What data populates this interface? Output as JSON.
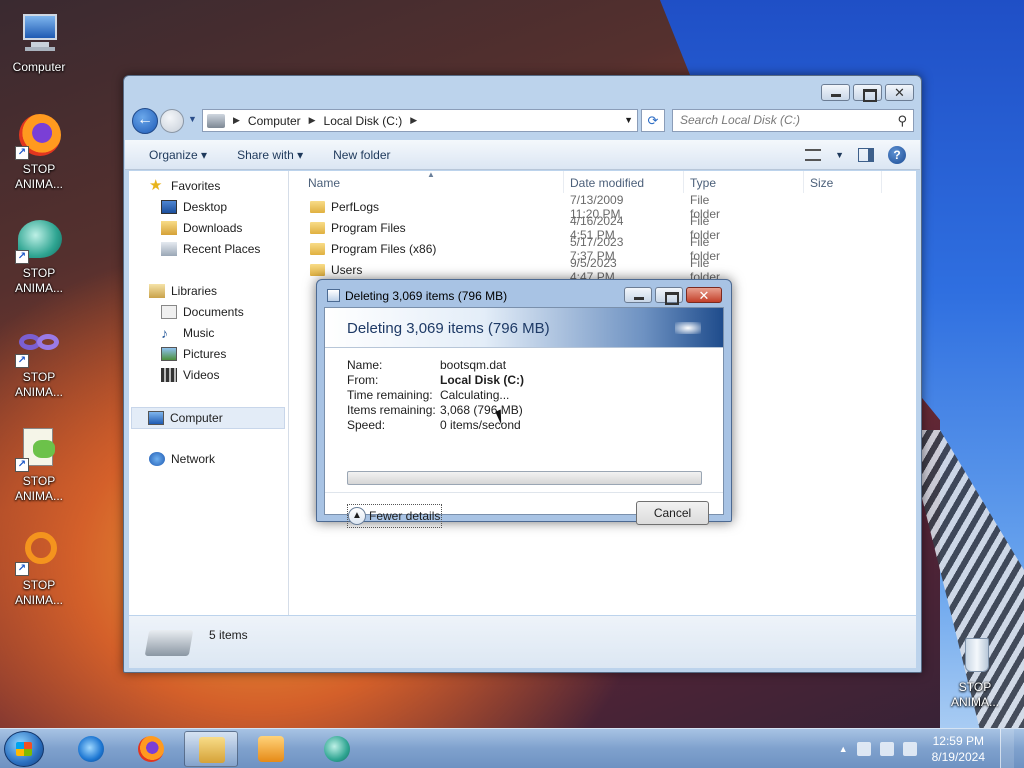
{
  "desktop": {
    "icons": [
      {
        "label": "Computer"
      },
      {
        "label": "STOP ANIMA..."
      },
      {
        "label": "STOP ANIMA..."
      },
      {
        "label": "STOP ANIMA..."
      },
      {
        "label": "STOP ANIMA..."
      },
      {
        "label": "STOP ANIMA..."
      }
    ],
    "recycle_label": "STOP ANIMA..."
  },
  "explorer": {
    "address": {
      "crumbs": [
        "Computer",
        "Local Disk (C:)"
      ]
    },
    "search_placeholder": "Search Local Disk (C:)",
    "toolbar": {
      "organize": "Organize",
      "share_with": "Share with",
      "new_folder": "New folder"
    },
    "nav": {
      "favorites": "Favorites",
      "desktop": "Desktop",
      "downloads": "Downloads",
      "recent_places": "Recent Places",
      "libraries": "Libraries",
      "documents": "Documents",
      "music": "Music",
      "pictures": "Pictures",
      "videos": "Videos",
      "computer": "Computer",
      "network": "Network"
    },
    "columns": {
      "name": "Name",
      "date": "Date modified",
      "type": "Type",
      "size": "Size"
    },
    "rows": [
      {
        "name": "PerfLogs",
        "date": "7/13/2009 11:20 PM",
        "type": "File folder"
      },
      {
        "name": "Program Files",
        "date": "4/16/2024 4:51 PM",
        "type": "File folder"
      },
      {
        "name": "Program Files (x86)",
        "date": "5/17/2023 7:37 PM",
        "type": "File folder"
      },
      {
        "name": "Users",
        "date": "9/5/2023 4:47 PM",
        "type": "File folder"
      }
    ],
    "status": {
      "items": "5 items"
    }
  },
  "dialog": {
    "title": "Deleting 3,069 items (796 MB)",
    "heading": "Deleting 3,069 items (796 MB)",
    "fields": [
      {
        "k": "Name:",
        "v": "bootsqm.dat"
      },
      {
        "k": "From:",
        "v": "Local Disk (C:)"
      },
      {
        "k": "Time remaining:",
        "v": "Calculating..."
      },
      {
        "k": "Items remaining:",
        "v": "3,068 (796 MB)"
      },
      {
        "k": "Speed:",
        "v": "0 items/second"
      }
    ],
    "progress": 0,
    "fewer_details": "Fewer details",
    "cancel": "Cancel"
  },
  "taskbar": {
    "time": "12:59 PM",
    "date": "8/19/2024",
    "tray_expand": "▲"
  },
  "colors": {
    "accent": "#1e5bb8",
    "progress": "#2ea51c"
  }
}
